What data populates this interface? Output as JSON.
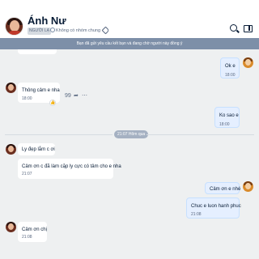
{
  "header": {
    "contact_name": "Ánh Nư",
    "stranger_tag": "NGƯỜI LẠ",
    "group_text": "Không có nhóm chung"
  },
  "notice": {
    "text": "Bạn đã gửi yêu cầu kết bạn và đang chờ người này đồng ý"
  },
  "messages": [
    {
      "side": "out",
      "text": "Ok e",
      "time": "18:00"
    },
    {
      "side": "in",
      "text": "Thông cảm e nha",
      "time": "18:00"
    },
    {
      "side": "out",
      "text": "Ko sao e",
      "time": "18:00"
    },
    {
      "side": "in",
      "text": "Ly đẹp lắm c ơi",
      "time": ""
    },
    {
      "side": "in",
      "text": "Cảm ơn c đã làm cặp ly cực có tâm cho e nha",
      "time": "21:07"
    },
    {
      "side": "out",
      "text": "Cảm ơn e nhé",
      "time": ""
    },
    {
      "side": "out",
      "text": "Chuc e luon hanh phuc",
      "time": "21:08"
    },
    {
      "side": "in",
      "text": "Cảm ơn chị",
      "time": "21:08"
    }
  ],
  "divider": {
    "text": "21:07 Hôm qua"
  },
  "actions": {
    "quote": "99",
    "share": "➦",
    "more": "⋯"
  },
  "icons": {
    "search": "search-icon",
    "sidebar": "sidebar-toggle-icon",
    "group": "group-icon",
    "tag": "tag-icon",
    "like": "thumbs-up-icon"
  },
  "colors": {
    "incoming_bubble": "#ffffff",
    "outgoing_bubble": "#e5efff",
    "chat_background": "#eef0f1",
    "notice_bar": "#7d8fa8"
  }
}
